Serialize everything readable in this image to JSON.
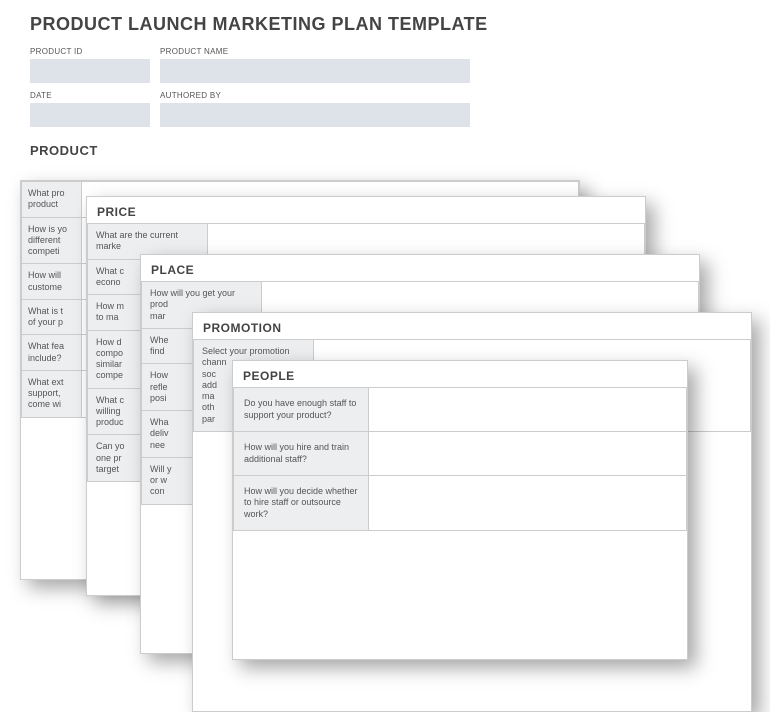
{
  "title": "PRODUCT LAUNCH MARKETING PLAN TEMPLATE",
  "fields": {
    "product_id_label": "PRODUCT ID",
    "product_name_label": "PRODUCT NAME",
    "date_label": "DATE",
    "authored_by_label": "AUTHORED BY"
  },
  "sections": {
    "product": {
      "heading": "PRODUCT",
      "q1": "What pro",
      "q2": "product",
      "q3": "How is yo",
      "q4": "different",
      "q5": "competi",
      "q6": "How will",
      "q7": "custome",
      "q8": "What is t",
      "q9": "of your p",
      "q10": "What fea",
      "q11": "include?",
      "q12": "What ext",
      "q13": "support,",
      "q14": "come wi"
    },
    "price": {
      "heading": "PRICE",
      "q1": "What are the current marke",
      "q2": "What c",
      "q3": "econo",
      "q4": "How m",
      "q5": "to ma",
      "q6": "How d",
      "q7": "compo",
      "q8": "similar",
      "q9": "compe",
      "q10": "What c",
      "q11": "willing",
      "q12": "produc",
      "q13": "Can yo",
      "q14": "one pr",
      "q15": "target"
    },
    "place": {
      "heading": "PLACE",
      "q1": "How will you get your prod",
      "q2": "mar",
      "q3": "Whe",
      "q4": "find",
      "q5": "How",
      "q6": "refle",
      "q7": "posi",
      "q8": "Wha",
      "q9": "deliv",
      "q10": "nee",
      "q11": "Will y",
      "q12": "or w",
      "q13": "con"
    },
    "promotion": {
      "heading": "PROMOTION",
      "q1": "Select your promotion chann",
      "q2": "soc",
      "q3": "add",
      "q4": "ma",
      "q5": "oth",
      "q6": "par"
    },
    "people": {
      "heading": "PEOPLE",
      "q1": "Do you have enough staff to support your product?",
      "q2": "How will you hire and train additional staff?",
      "q3": "How will you decide whether to hire staff or outsource work?"
    }
  }
}
